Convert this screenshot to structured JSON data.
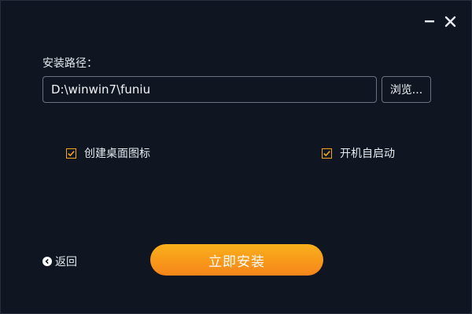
{
  "window": {
    "minimize_icon": "minimize-icon",
    "close_icon": "close-icon"
  },
  "install_path": {
    "label": "安装路径：",
    "value": "D:\\winwin7\\funiu",
    "browse_label": "浏览..."
  },
  "options": {
    "desktop_shortcut": {
      "label": "创建桌面图标",
      "checked": true
    },
    "autostart": {
      "label": "开机自启动",
      "checked": true
    }
  },
  "footer": {
    "back_label": "返回",
    "install_label": "立即安装"
  },
  "colors": {
    "background": "#0f1622",
    "accent": "#f2a81d",
    "button_gradient_top": "#f9b01b",
    "button_gradient_bottom": "#f6851a"
  }
}
